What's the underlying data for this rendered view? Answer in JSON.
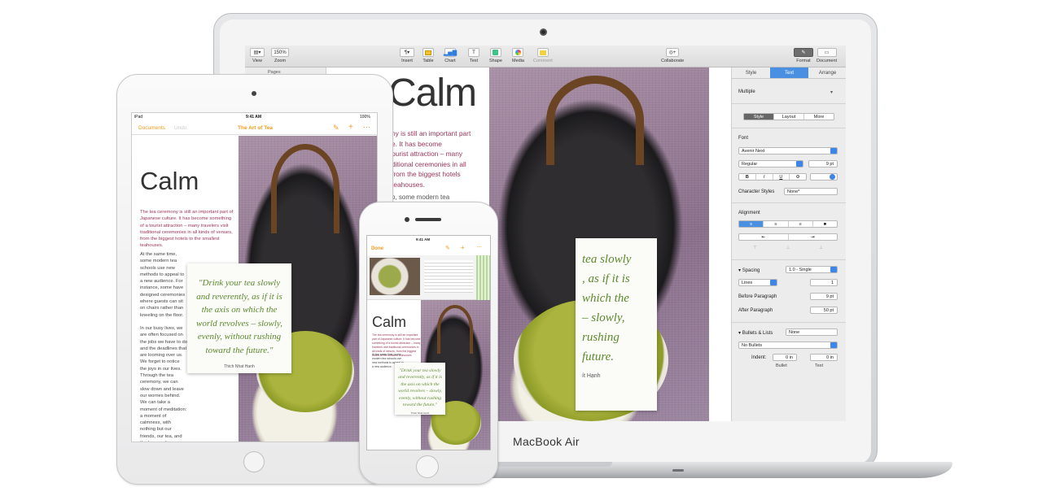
{
  "mac": {
    "brand": "MacBook Air",
    "toolbar": {
      "view": "View",
      "zoom_value": "150%",
      "zoom": "Zoom",
      "insert": "Insert",
      "table": "Table",
      "chart": "Chart",
      "text": "Text",
      "shape": "Shape",
      "media": "Media",
      "comment": "Comment",
      "collaborate": "Collaborate",
      "format": "Format",
      "document": "Document"
    },
    "pages_title": "Pages",
    "doc": {
      "title": "Calm",
      "intro_lines": [
        "ny is still an important part",
        "e. It has become",
        "ourist attraction – many",
        "ditional ceremonies in all",
        "from the biggest hotels",
        "teahouses."
      ],
      "body_fragment": "o, some modern tea",
      "quote_lines": [
        "tea slowly",
        ", as if it is",
        "which the",
        "– slowly,",
        "rushing",
        "future."
      ],
      "quote_author": "ít Hạnh"
    },
    "inspector": {
      "tabs": [
        "Style",
        "Text",
        "Arrange"
      ],
      "active_tab": "Text",
      "paragraph_style": "Multiple",
      "subtabs": [
        "Style",
        "Layout",
        "More"
      ],
      "font_label": "Font",
      "font_name": "Avenir Next",
      "font_weight": "Regular",
      "font_size": "9 pt",
      "format_buttons": [
        "B",
        "I",
        "U",
        "⚙"
      ],
      "character_styles_label": "Character Styles",
      "character_styles_value": "None*",
      "alignment_label": "Alignment",
      "spacing_label": "Spacing",
      "spacing_value": "1.0 - Single",
      "lines_label": "Lines",
      "lines_value": "1",
      "before_paragraph_label": "Before Paragraph",
      "before_paragraph_value": "9 pt",
      "after_paragraph_label": "After Paragraph",
      "after_paragraph_value": "50 pt",
      "bullets_label": "Bullets & Lists",
      "bullets_value": "None",
      "no_bullets": "No Bullets",
      "indent_label": "Indent:",
      "bullet_indent": "0 in",
      "text_indent": "0 in",
      "bullet_caption": "Bullet",
      "text_caption": "Text"
    }
  },
  "ipad": {
    "status_left": "iPad",
    "status_time": "9:41 AM",
    "status_right": "100%",
    "nav_documents": "Documents",
    "nav_undo": "Undo",
    "nav_title": "The Art of Tea",
    "title": "Calm",
    "intro": "The tea ceremony is still an important part of Japanese culture. It has become something of a tourist attraction – many travelers visit traditional ceremonies in all kinds of venues, from the biggest hotels to the smallest teahouses.",
    "body_1": "At the same time, some modern tea schools use new methods to appeal to a new audience. For instance, some have designed ceremonies where guests can sit on chairs rather than kneeling on the floor.",
    "body_2": "In our busy lives, we are often focused on the jobs we have to do and the deadlines that are looming over us. We forget to notice the joys in our lives. Through the tea ceremony, we can slow down and leave our worries behind. We can take a moment of meditation: a moment of calmness, with nothing but our friends, our tea, and the here and now.",
    "quote": "\"Drink your tea slowly and reverently, as if it is the axis on which the world revolves – slowly, evenly, without rushing toward the future.\"",
    "quote_author": "Thich Nhat Hanh"
  },
  "iphone": {
    "status_time": "9:41 AM",
    "nav_done": "Done",
    "title": "Calm",
    "intro": "The tea ceremony is still an important part of Japanese culture. It has become something of a tourist attraction – many travelers visit traditional ceremonies in all kinds of venues, from the biggest hotels to the smallest teahouses.",
    "body": "At the same time, some modern tea schools use new methods to appeal to a new audience.",
    "quote": "\"Drink your tea slowly and reverently, as if it is the axis on which the world revolves – slowly, evenly, without rushing toward the future.\"",
    "quote_author": "Thich Nhat Hanh"
  },
  "colors": {
    "accent_blue": "#4a90e2",
    "pages_orange": "#f29a1e",
    "intro_red": "#9c3559",
    "quote_green": "#5b8a2c"
  }
}
